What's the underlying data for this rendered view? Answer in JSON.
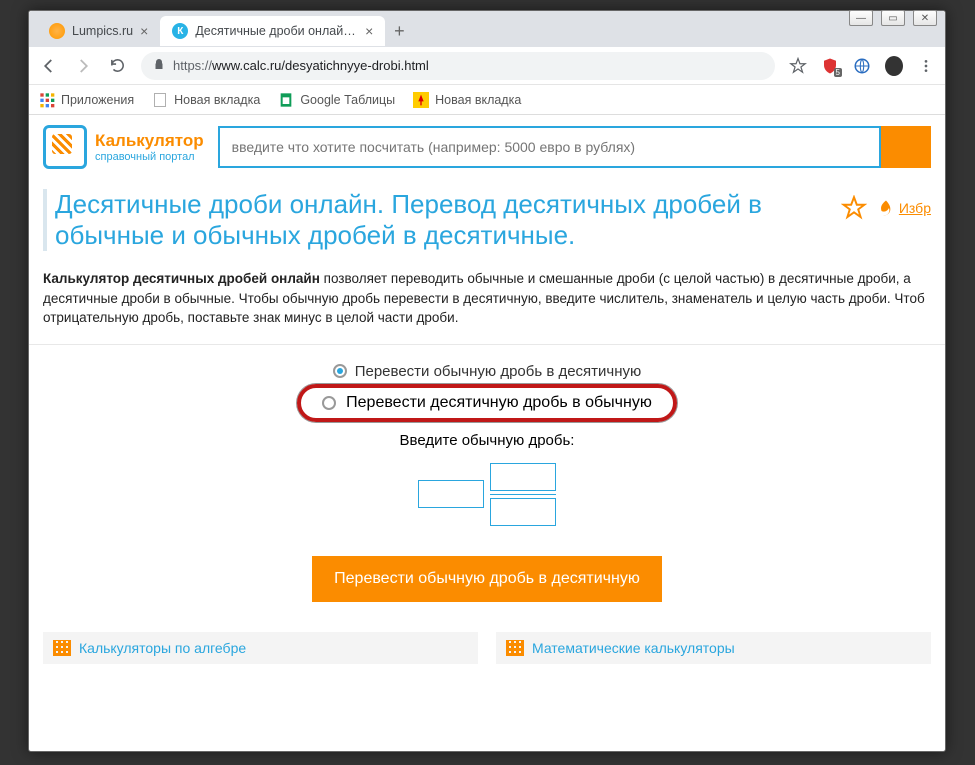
{
  "tabs": [
    {
      "title": "Lumpics.ru"
    },
    {
      "title": "Десятичные дроби онлайн. Пер"
    }
  ],
  "url": {
    "proto": "https://",
    "rest": "www.calc.ru/desyatichnyye-drobi.html"
  },
  "bookmarks": {
    "apps": "Приложения",
    "b1": "Новая вкладка",
    "b2": "Google Таблицы",
    "b3": "Новая вкладка"
  },
  "logo": {
    "line1": "Калькулятор",
    "line2": "справочный портал"
  },
  "search": {
    "placeholder": "введите что хотите посчитать (например: 5000 евро в рублях)"
  },
  "page": {
    "h1": "Десятичные дроби онлайн. Перевод десятичных дробей в обычные и обычных дробей в десятичные.",
    "fav_link": "Избр",
    "desc_bold": "Калькулятор десятичных дробей онлайн",
    "desc_rest": " позволяет переводить обычные и смешанные дроби (с целой частью) в десятичные дроби, а десятичные дроби в обычные. Чтобы обычную дробь перевести в десятичную, введите числитель, знаменатель и целую часть дроби. Чтоб отрицательную дробь, поставьте знак минус в целой части дроби.",
    "radio1": "Перевести обычную дробь в десятичную",
    "radio2": "Перевести десятичную дробь в обычную",
    "prompt": "Введите обычную дробь:",
    "button": "Перевести обычную дробь в десятичную"
  },
  "cats": {
    "c1": "Калькуляторы по алгебре",
    "c2": "Математические калькуляторы"
  },
  "ext_badge": "5"
}
